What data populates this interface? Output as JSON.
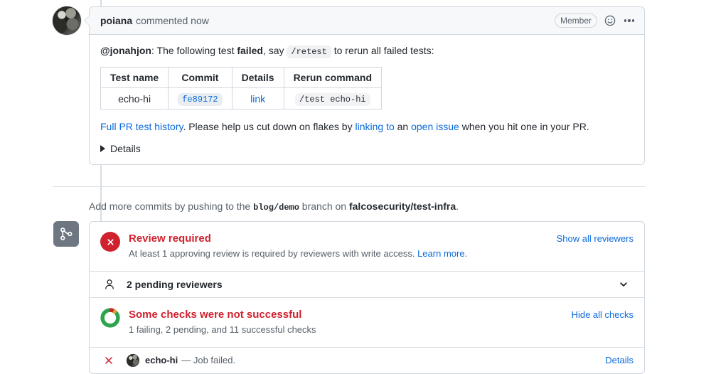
{
  "comment": {
    "author": "poiana",
    "meta": "commented now",
    "badge": "Member",
    "intro": {
      "mention": "@jonahjon",
      "text_1": ": The following test ",
      "bold_word": "failed",
      "text_2": ", say ",
      "code": "/retest",
      "text_3": " to rerun all failed tests:"
    },
    "table": {
      "headers": [
        "Test name",
        "Commit",
        "Details",
        "Rerun command"
      ],
      "rows": [
        {
          "test_name": "echo-hi",
          "commit": "fe89172",
          "details": "link",
          "rerun_command": "/test echo-hi"
        }
      ]
    },
    "flakes": {
      "link_history": "Full PR test history",
      "text_1": ". Please help us cut down on flakes by ",
      "link_linking": "linking to",
      "text_2": " an ",
      "link_issue": "open issue",
      "text_3": " when you hit one in your PR."
    },
    "details_summary": "Details"
  },
  "push_line": {
    "text_1": "Add more commits by pushing to the ",
    "branch": "blog/demo",
    "text_2": " branch on ",
    "repo": "falcosecurity/test-infra",
    "text_3": "."
  },
  "merge_box": {
    "review": {
      "title": "Review required",
      "subtitle": "At least 1 approving review is required by reviewers with write access.",
      "learn_more": "Learn more.",
      "action": "Show all reviewers"
    },
    "pending_reviewers": {
      "label": "2 pending reviewers"
    },
    "checks": {
      "title": "Some checks were not successful",
      "subtitle": "1 failing, 2 pending, and 11 successful checks",
      "action": "Hide all checks"
    },
    "check_rows": [
      {
        "name": "echo-hi",
        "description": "— Job failed.",
        "details": "Details"
      }
    ]
  },
  "colors": {
    "danger": "#cf222e",
    "success": "#2da44e",
    "pending": "#bf8700",
    "link": "#0969da",
    "muted": "#57606a",
    "border": "#d0d7de"
  }
}
